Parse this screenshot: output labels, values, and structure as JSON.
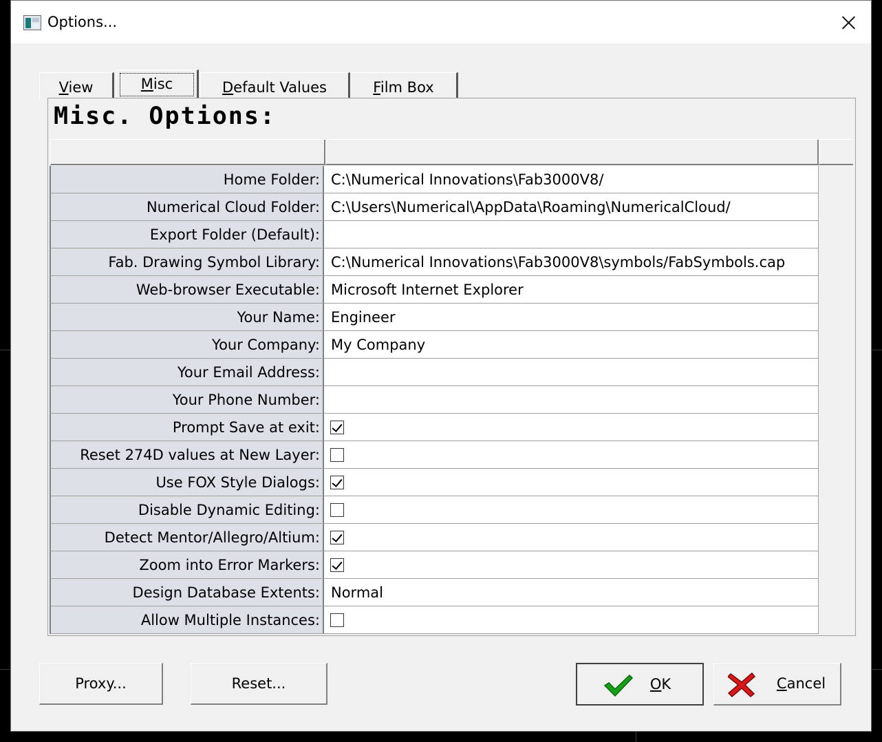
{
  "window": {
    "title": "Options..."
  },
  "tabs": [
    {
      "label": "View",
      "active": false
    },
    {
      "label": "Misc",
      "active": true
    },
    {
      "label": "Default Values",
      "active": false
    },
    {
      "label": "Film Box",
      "active": false
    }
  ],
  "panel": {
    "heading": "Misc. Options:"
  },
  "rows": [
    {
      "label": "Home Folder:",
      "type": "text",
      "value": "C:\\Numerical Innovations\\Fab3000V8/"
    },
    {
      "label": "Numerical Cloud Folder:",
      "type": "text",
      "value": "C:\\Users\\Numerical\\AppData\\Roaming\\NumericalCloud/"
    },
    {
      "label": "Export Folder (Default):",
      "type": "text",
      "value": ""
    },
    {
      "label": "Fab. Drawing Symbol Library:",
      "type": "text",
      "value": "C:\\Numerical Innovations\\Fab3000V8\\symbols/FabSymbols.cap"
    },
    {
      "label": "Web-browser Executable:",
      "type": "text",
      "value": "Microsoft Internet Explorer"
    },
    {
      "label": "Your Name:",
      "type": "text",
      "value": "Engineer"
    },
    {
      "label": "Your Company:",
      "type": "text",
      "value": "My Company"
    },
    {
      "label": "Your Email Address:",
      "type": "text",
      "value": ""
    },
    {
      "label": "Your Phone Number:",
      "type": "text",
      "value": ""
    },
    {
      "label": "Prompt Save at exit:",
      "type": "checkbox",
      "checked": true
    },
    {
      "label": "Reset 274D values at New Layer:",
      "type": "checkbox",
      "checked": false
    },
    {
      "label": "Use FOX Style Dialogs:",
      "type": "checkbox",
      "checked": true
    },
    {
      "label": "Disable Dynamic Editing:",
      "type": "checkbox",
      "checked": false
    },
    {
      "label": "Detect Mentor/Allegro/Altium:",
      "type": "checkbox",
      "checked": true
    },
    {
      "label": "Zoom into Error Markers:",
      "type": "checkbox",
      "checked": true
    },
    {
      "label": "Design Database Extents:",
      "type": "text",
      "value": "Normal"
    },
    {
      "label": "Allow Multiple Instances:",
      "type": "checkbox",
      "checked": false
    }
  ],
  "buttons": {
    "proxy": "Proxy...",
    "reset": "Reset...",
    "ok": "OK",
    "cancel": "Cancel"
  },
  "icons": {
    "ok": "green-check-icon",
    "cancel": "red-x-icon"
  },
  "colors": {
    "ok_icon": "#18a018",
    "cancel_icon": "#d81818",
    "label_bg": "#dde0e7"
  }
}
